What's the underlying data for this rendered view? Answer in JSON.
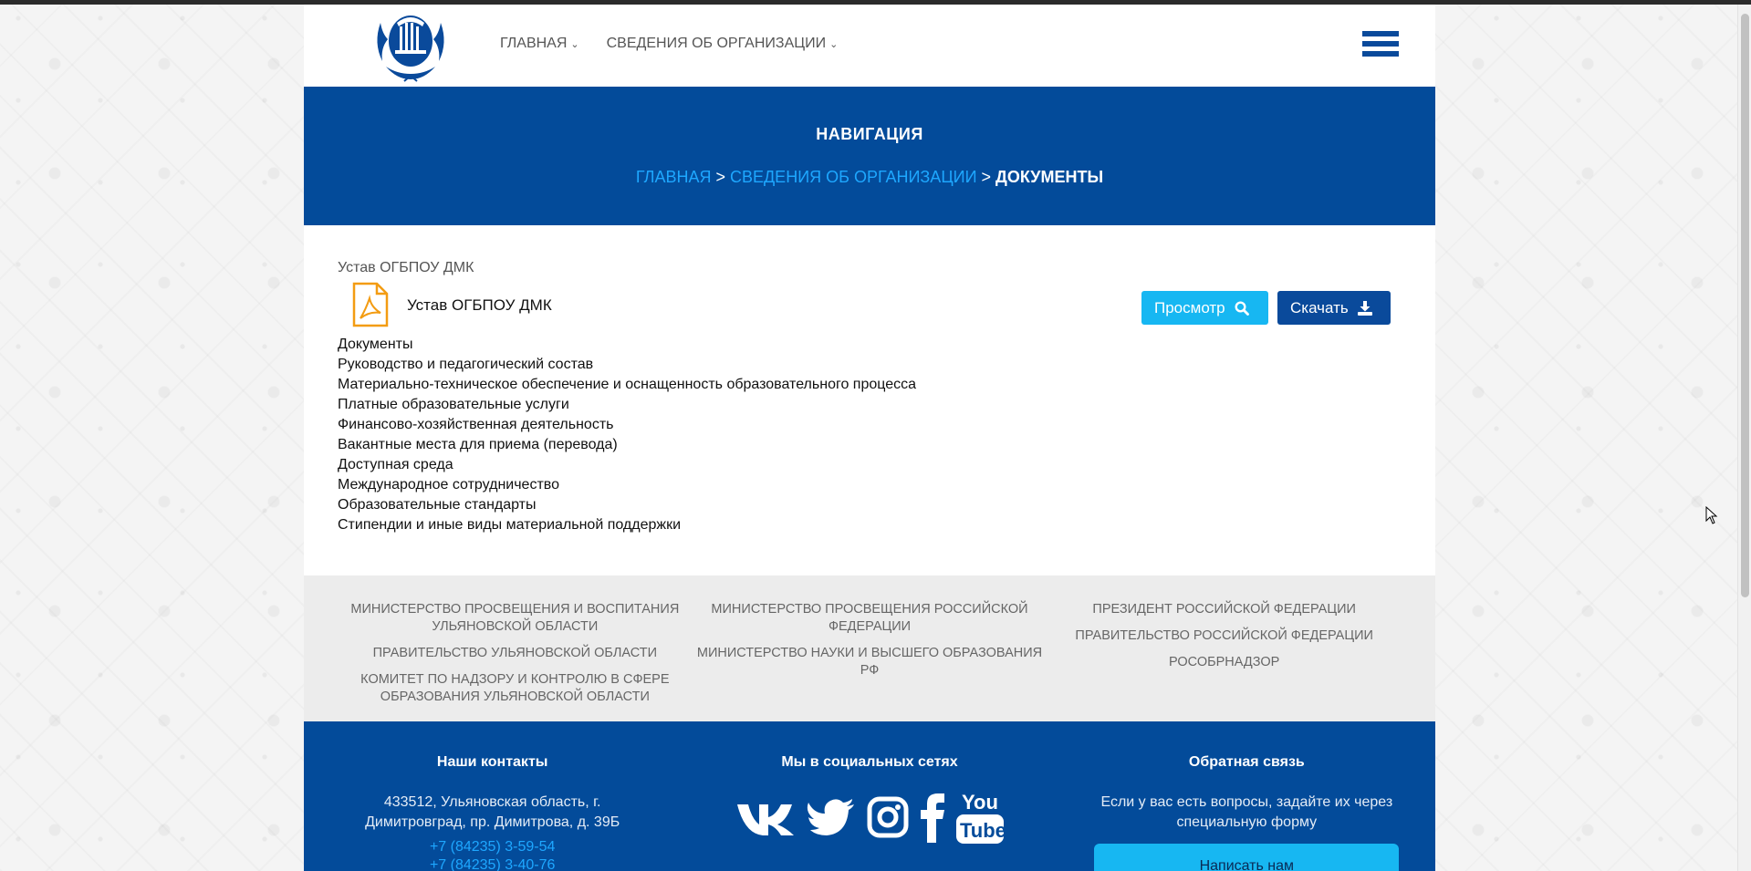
{
  "header": {
    "nav": [
      {
        "label": "ГЛАВНАЯ"
      },
      {
        "label": "СВЕДЕНИЯ ОБ ОРГАНИЗАЦИИ"
      }
    ]
  },
  "navband": {
    "title": "НАВИГАЦИЯ",
    "breadcrumb": {
      "home": "ГЛАВНАЯ",
      "parent": "СВЕДЕНИЯ ОБ ОРГАНИЗАЦИИ",
      "current": "ДОКУМЕНТЫ",
      "separator": ">"
    }
  },
  "content": {
    "section_title": "Устав ОГБПОУ ДМК",
    "document": {
      "name": "Устав ОГБПОУ ДМК",
      "view_label": "Просмотр",
      "download_label": "Скачать"
    },
    "links": [
      "Документы",
      "Руководство и педагогический состав",
      "Материально-техническое обеспечение и оснащенность образовательного процесса",
      "Платные образовательные услуги",
      "Финансово-хозяйственная деятельность",
      "Вакантные места для приема (перевода)",
      "Доступная среда",
      "Международное сотрудничество",
      "Образовательные стандарты",
      "Стипендии и иные виды материальной поддержки"
    ]
  },
  "orgs": {
    "col1": [
      "МИНИСТЕРСТВО ПРОСВЕЩЕНИЯ И ВОСПИТАНИЯ УЛЬЯНОВСКОЙ ОБЛАСТИ",
      "ПРАВИТЕЛЬСТВО УЛЬЯНОВСКОЙ ОБЛАСТИ",
      "КОМИТЕТ ПО НАДЗОРУ И КОНТРОЛЮ В СФЕРЕ ОБРАЗОВАНИЯ УЛЬЯНОВСКОЙ ОБЛАСТИ"
    ],
    "col2": [
      "МИНИСТЕРСТВО ПРОСВЕЩЕНИЯ РОССИЙСКОЙ ФЕДЕРАЦИИ",
      "МИНИСТЕРСТВО НАУКИ И ВЫСШЕГО ОБРАЗОВАНИЯ РФ"
    ],
    "col3": [
      "ПРЕЗИДЕНТ РОССИЙСКОЙ ФЕДЕРАЦИИ",
      "ПРАВИТЕЛЬСТВО РОССИЙСКОЙ ФЕДЕРАЦИИ",
      "РОСОБРНАДЗОР"
    ]
  },
  "footer": {
    "contacts_title": "Наши контакты",
    "address": "433512, Ульяновская область, г. Димитровград, пр. Димитрова, д. 39Б",
    "phones": [
      "+7 (84235) 3-59-54",
      "+7 (84235) 3-40-76"
    ],
    "social_title": "Мы в социальных сетях",
    "social_icons": [
      "vk-icon",
      "twitter-icon",
      "instagram-icon",
      "facebook-icon",
      "youtube-icon"
    ],
    "youtube_logo": {
      "you": "You",
      "tube": "Tube"
    },
    "feedback_title": "Обратная связь",
    "feedback_text": "Если у вас есть вопросы, задайте их через специальную форму",
    "feedback_button": "Написать нам"
  },
  "colors": {
    "brand_blue": "#034b9a",
    "accent_cyan": "#17b7f2",
    "link_blue": "#1ea7ff"
  }
}
